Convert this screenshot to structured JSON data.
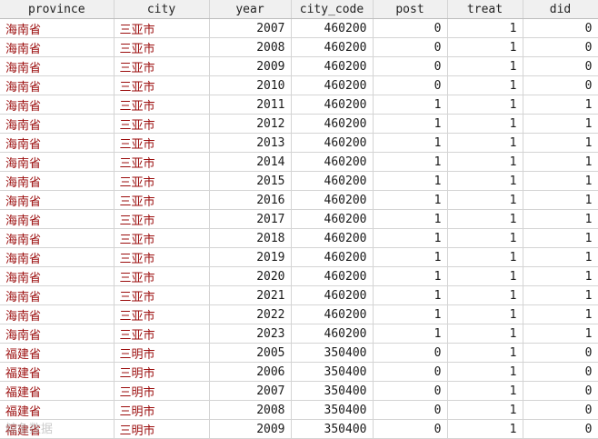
{
  "table": {
    "columns": [
      "province",
      "city",
      "year",
      "city_code",
      "post",
      "treat",
      "did"
    ],
    "rows": [
      [
        "海南省",
        "三亚市",
        "2007",
        "460200",
        "0",
        "1",
        "0"
      ],
      [
        "海南省",
        "三亚市",
        "2008",
        "460200",
        "0",
        "1",
        "0"
      ],
      [
        "海南省",
        "三亚市",
        "2009",
        "460200",
        "0",
        "1",
        "0"
      ],
      [
        "海南省",
        "三亚市",
        "2010",
        "460200",
        "0",
        "1",
        "0"
      ],
      [
        "海南省",
        "三亚市",
        "2011",
        "460200",
        "1",
        "1",
        "1"
      ],
      [
        "海南省",
        "三亚市",
        "2012",
        "460200",
        "1",
        "1",
        "1"
      ],
      [
        "海南省",
        "三亚市",
        "2013",
        "460200",
        "1",
        "1",
        "1"
      ],
      [
        "海南省",
        "三亚市",
        "2014",
        "460200",
        "1",
        "1",
        "1"
      ],
      [
        "海南省",
        "三亚市",
        "2015",
        "460200",
        "1",
        "1",
        "1"
      ],
      [
        "海南省",
        "三亚市",
        "2016",
        "460200",
        "1",
        "1",
        "1"
      ],
      [
        "海南省",
        "三亚市",
        "2017",
        "460200",
        "1",
        "1",
        "1"
      ],
      [
        "海南省",
        "三亚市",
        "2018",
        "460200",
        "1",
        "1",
        "1"
      ],
      [
        "海南省",
        "三亚市",
        "2019",
        "460200",
        "1",
        "1",
        "1"
      ],
      [
        "海南省",
        "三亚市",
        "2020",
        "460200",
        "1",
        "1",
        "1"
      ],
      [
        "海南省",
        "三亚市",
        "2021",
        "460200",
        "1",
        "1",
        "1"
      ],
      [
        "海南省",
        "三亚市",
        "2022",
        "460200",
        "1",
        "1",
        "1"
      ],
      [
        "海南省",
        "三亚市",
        "2023",
        "460200",
        "1",
        "1",
        "1"
      ],
      [
        "福建省",
        "三明市",
        "2005",
        "350400",
        "0",
        "1",
        "0"
      ],
      [
        "福建省",
        "三明市",
        "2006",
        "350400",
        "0",
        "1",
        "0"
      ],
      [
        "福建省",
        "三明市",
        "2007",
        "350400",
        "0",
        "1",
        "0"
      ],
      [
        "福建省",
        "三明市",
        "2008",
        "350400",
        "0",
        "1",
        "0"
      ],
      [
        "福建省",
        "三明市",
        "2009",
        "350400",
        "0",
        "1",
        "0"
      ]
    ]
  },
  "colors": {
    "text_cell": "#9b0d0d",
    "numeric_cell": "#1a1a1a",
    "header_bg": "#f0f0f0",
    "grid_line": "#d4d4d4"
  },
  "watermark": "鲸鱼数据"
}
